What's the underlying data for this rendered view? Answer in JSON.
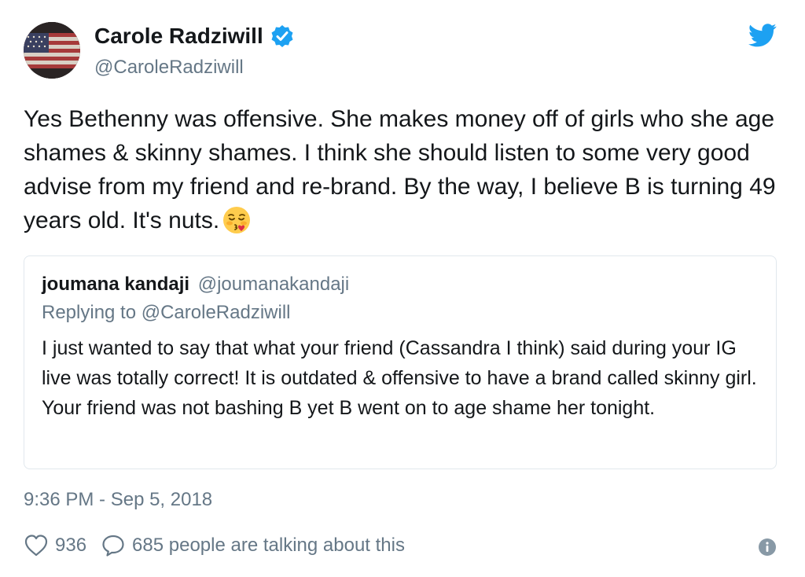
{
  "author": {
    "display_name": "Carole Radziwill",
    "handle": "@CaroleRadziwill",
    "verified": true
  },
  "tweet": {
    "text": "Yes Bethenny was offensive. She makes money off of girls who she age shames & skinny shames. I think she should listen to some very good advise from my friend and re-brand. By the way, I believe B is turning 49 years old. It's nuts.",
    "emoji_icon": "face-blowing-kiss-icon",
    "timestamp": "9:36 PM - Sep 5, 2018"
  },
  "quoted_tweet": {
    "display_name": "joumana kandaji",
    "handle": "@joumanakandaji",
    "replying_to": "Replying to @CaroleRadziwill",
    "text": "I just wanted to say that what your friend (Cassandra I think) said during your IG live was totally correct! It is outdated & offensive to have a brand called skinny girl. Your friend was not bashing B yet B went on to age shame her tonight."
  },
  "stats": {
    "likes": "936",
    "talking": "685 people are talking about this"
  },
  "colors": {
    "twitter_blue": "#1da1f2",
    "muted_text": "#657786",
    "border": "#e1e8ed"
  }
}
